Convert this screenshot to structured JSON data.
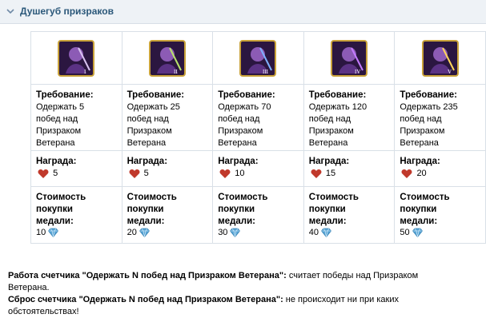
{
  "header": {
    "title": "Душегуб призраков"
  },
  "labels": {
    "requirement": "Требование:",
    "reward": "Награда:",
    "cost_line1": "Стоимость",
    "cost_line2": "покупки",
    "cost_line3": "медали:"
  },
  "medals": [
    {
      "roman": "I",
      "req": [
        "Одержать 5",
        "побед над",
        "Призраком",
        "Ветерана"
      ],
      "reward": "5",
      "cost": "10"
    },
    {
      "roman": "II",
      "req": [
        "Одержать 25",
        "побед над",
        "Призраком",
        "Ветерана"
      ],
      "reward": "5",
      "cost": "20"
    },
    {
      "roman": "III",
      "req": [
        "Одержать 70",
        "побед над",
        "Призраком",
        "Ветерана"
      ],
      "reward": "10",
      "cost": "30"
    },
    {
      "roman": "IV",
      "req": [
        "Одержать 120",
        "побед над",
        "Призраком",
        "Ветерана"
      ],
      "reward": "15",
      "cost": "40"
    },
    {
      "roman": "V",
      "req": [
        "Одержать 235",
        "побед над",
        "Призраком",
        "Ветерана"
      ],
      "reward": "20",
      "cost": "50"
    }
  ],
  "footer": {
    "counter_bold": "Работа счетчика \"Одержать N побед над Призраком Ветерана\":",
    "counter_text": " считает победы над Призраком",
    "counter_text2": "Ветерана.",
    "reset_bold": "Сброс счетчика \"Одержать N побед над Призраком Ветерана\":",
    "reset_text": " не происходит ни при каких",
    "reset_text2": "обстоятельствах!"
  },
  "colors": {
    "header_bg": "#eef2f6",
    "title": "#2b587a",
    "heart": "#c0392b",
    "gem": "#5aa6d6",
    "medal_frame": "#c9a23a"
  },
  "icons": {
    "heart": "heart-icon",
    "gem": "gem-icon",
    "chevron": "chevron-down-icon"
  }
}
